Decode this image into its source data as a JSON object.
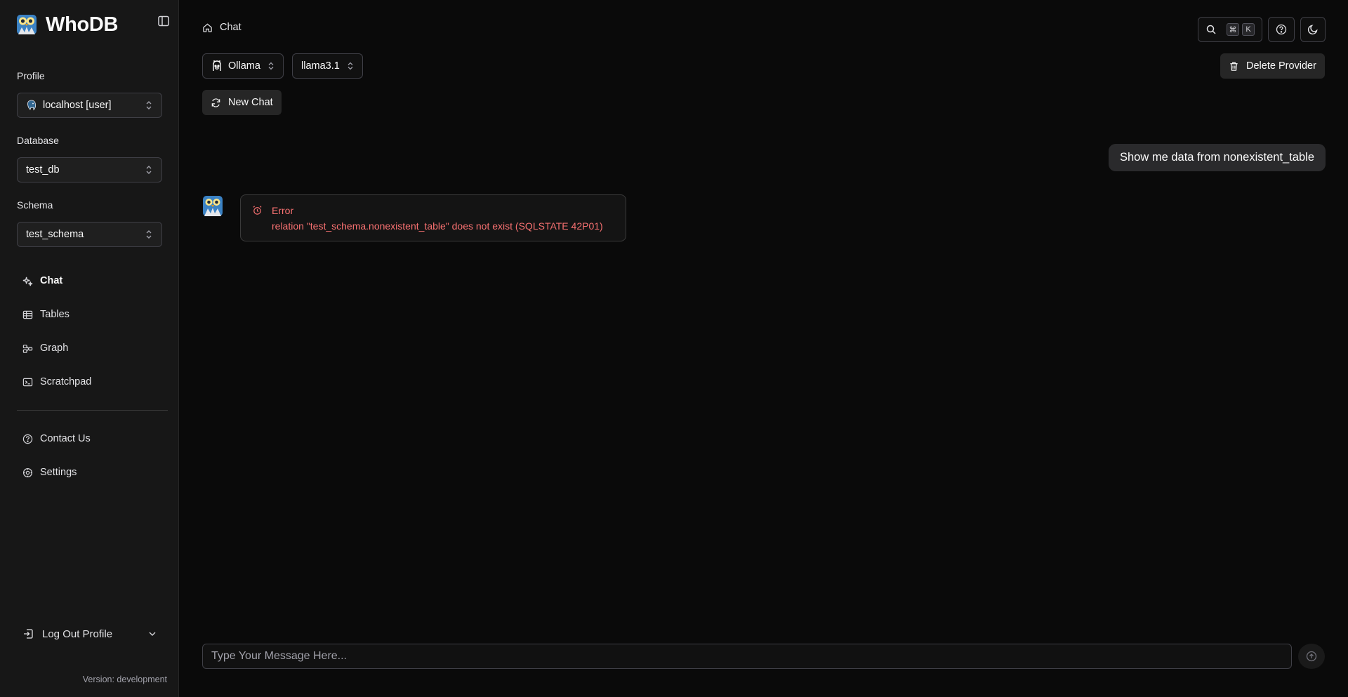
{
  "app": {
    "name": "WhoDB",
    "version_text": "Version: development"
  },
  "sidebar": {
    "profile_label": "Profile",
    "profile_value": "localhost [user]",
    "database_label": "Database",
    "database_value": "test_db",
    "schema_label": "Schema",
    "schema_value": "test_schema",
    "nav": [
      {
        "label": "Chat",
        "icon": "sparkles-icon",
        "active": true
      },
      {
        "label": "Tables",
        "icon": "table-icon"
      },
      {
        "label": "Graph",
        "icon": "graph-icon"
      },
      {
        "label": "Scratchpad",
        "icon": "terminal-icon"
      }
    ],
    "secondary_nav": [
      {
        "label": "Contact Us",
        "icon": "help-circle-icon"
      },
      {
        "label": "Settings",
        "icon": "gear-icon"
      }
    ],
    "logout_label": "Log Out Profile"
  },
  "header": {
    "breadcrumb": "Chat",
    "shortcut_keys": [
      "⌘",
      "K"
    ]
  },
  "toolbar": {
    "provider": "Ollama",
    "model": "llama3.1",
    "delete_provider_label": "Delete Provider",
    "new_chat_label": "New Chat"
  },
  "chat": {
    "user_message": "Show me data from nonexistent_table",
    "error_title": "Error",
    "error_message": "relation \"test_schema.nonexistent_table\" does not exist (SQLSTATE 42P01)",
    "input_placeholder": "Type Your Message Here..."
  },
  "colors": {
    "background": "#0a0a0a",
    "sidebar": "#171717",
    "error": "#f87171"
  }
}
